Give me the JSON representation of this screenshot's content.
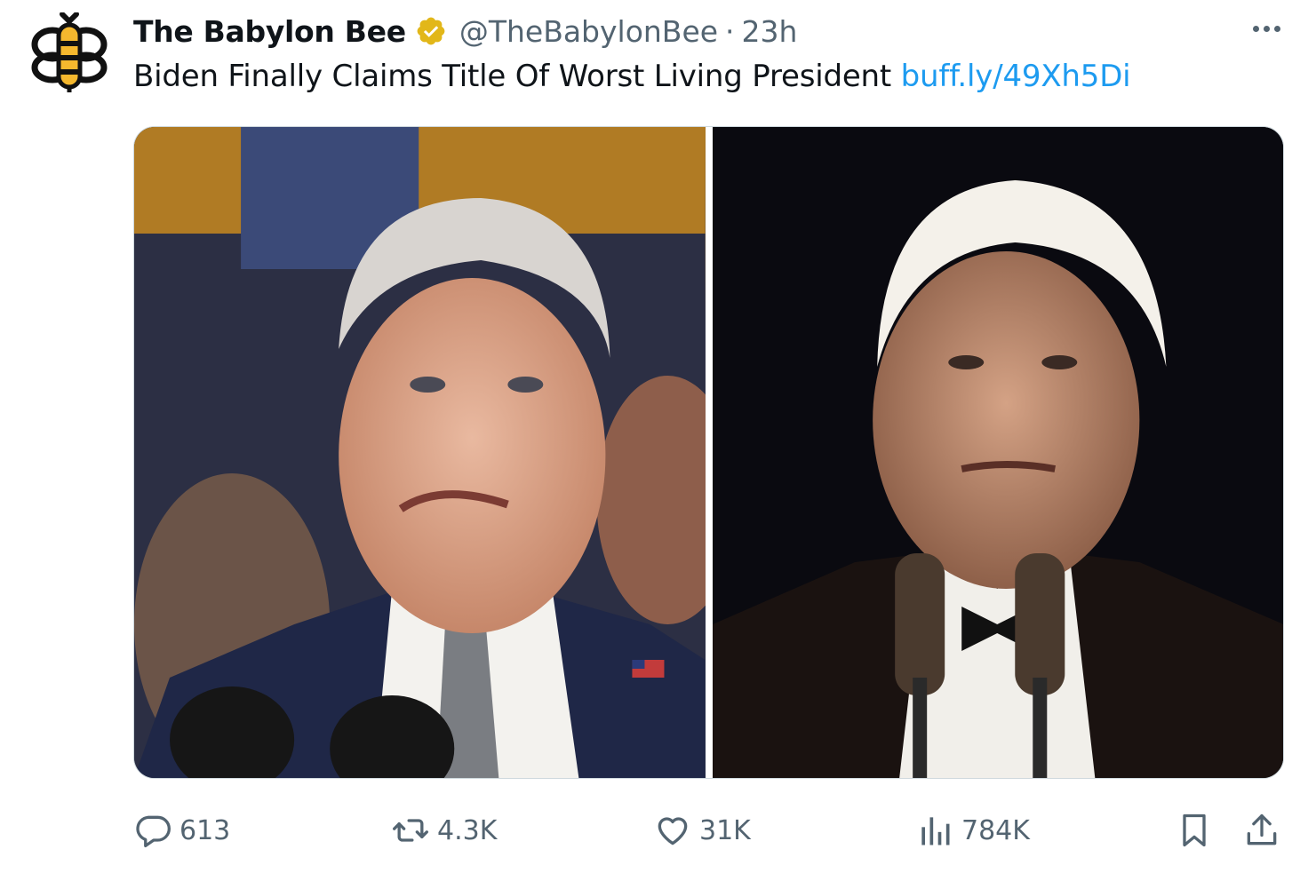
{
  "tweet": {
    "author": {
      "display_name": "The Babylon Bee",
      "handle": "@TheBabylonBee",
      "verified": true,
      "avatar_icon": "babylon-bee-logo-icon"
    },
    "time": "23h",
    "separator": "·",
    "text": "Biden Finally Claims Title Of Worst Living President",
    "link": "buff.ly/49Xh5Di",
    "media": [
      {
        "type": "photo",
        "icon": "photo-left"
      },
      {
        "type": "photo",
        "icon": "photo-right"
      }
    ],
    "actions": {
      "reply": {
        "icon": "reply-icon",
        "count": "613"
      },
      "retweet": {
        "icon": "retweet-icon",
        "count": "4.3K"
      },
      "like": {
        "icon": "heart-icon",
        "count": "31K"
      },
      "views": {
        "icon": "views-icon",
        "count": "784K"
      },
      "bookmark": {
        "icon": "bookmark-icon"
      },
      "share": {
        "icon": "share-icon"
      }
    }
  },
  "colors": {
    "text": "#0f1419",
    "secondary": "#536471",
    "link": "#1d9bf0",
    "verified_gold": "#e2b719",
    "border": "#cfd9de"
  }
}
